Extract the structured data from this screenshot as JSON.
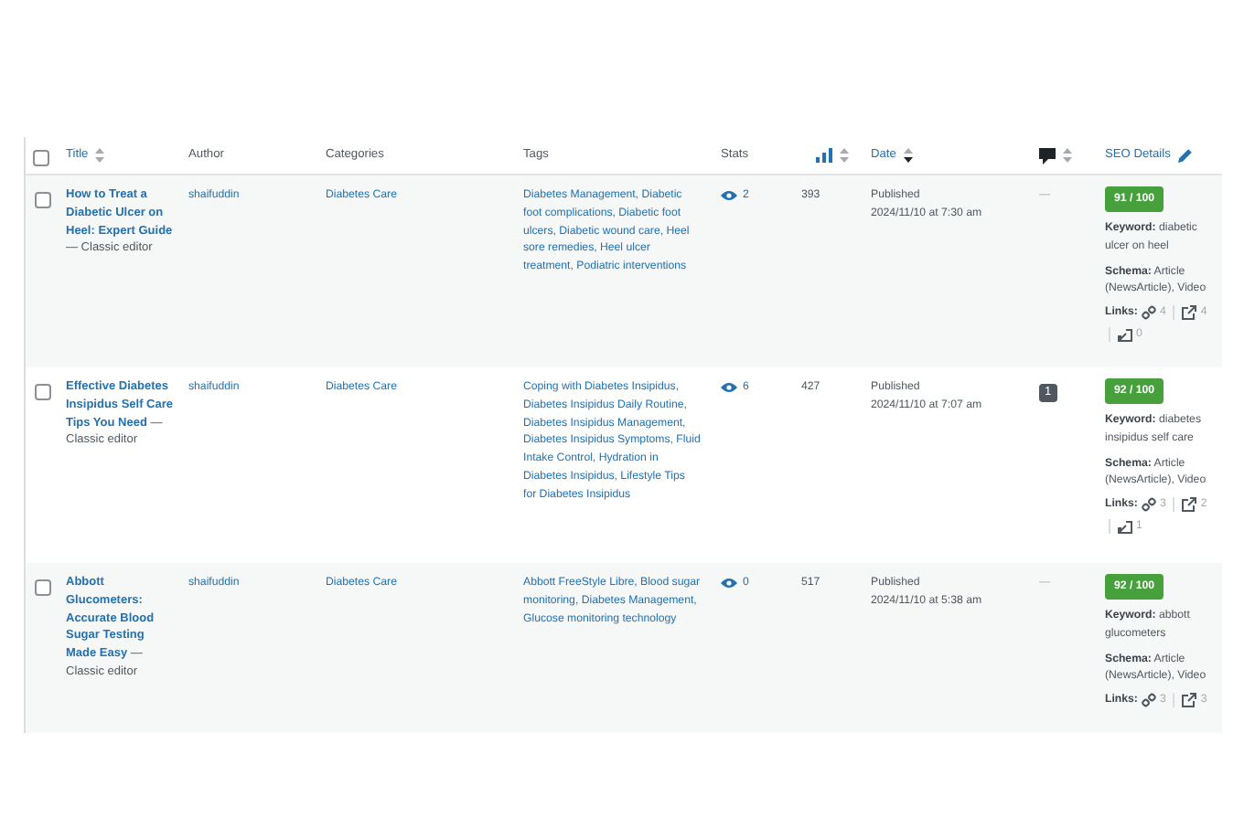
{
  "header": {
    "select_all": {
      "checked": false
    },
    "columns": [
      {
        "kind": "sortable",
        "label": "Title"
      },
      {
        "kind": "plain",
        "label": "Author"
      },
      {
        "kind": "plain",
        "label": "Categories"
      },
      {
        "kind": "plain",
        "label": "Tags"
      },
      {
        "kind": "plain",
        "label": "Stats"
      },
      {
        "kind": "chart-sort"
      },
      {
        "kind": "sortable-active",
        "label": "Date"
      },
      {
        "kind": "comment-sort"
      },
      {
        "kind": "seo",
        "label": "SEO Details"
      }
    ]
  },
  "rows": [
    {
      "checked": false,
      "title": "How to Treat a Diabetic Ulcer on Heel: Expert Guide",
      "editor": "— Classic editor",
      "author": "shaifuddin",
      "category": "Diabetes Care",
      "tags": "Diabetes Management, Diabetic foot complications, Diabetic foot ulcers, Diabetic wound care, Heel sore remedies, Heel ulcer treatment, Podiatric interventions",
      "views": "2",
      "count": "393",
      "status": "Published",
      "date": "2024/11/10 at 7:30 am",
      "comments": {
        "kind": "dash",
        "text": "—"
      },
      "score": "91 / 100",
      "keyword": "**Keyword:** diabetic ulcer on heel",
      "schema": "**Schema:** Article (NewsArticle), Video",
      "links_label": "Links:",
      "internal": "4",
      "external": "4",
      "incoming": "0"
    },
    {
      "checked": false,
      "title": "Effective Diabetes Insipidus Self Care Tips You Need",
      "editor": "— Classic editor",
      "author": "shaifuddin",
      "category": "Diabetes Care",
      "tags": "Coping with Diabetes Insipidus, Diabetes Insipidus Daily Routine, Diabetes Insipidus Management, Diabetes Insipidus Symptoms, Fluid Intake Control, Hydration in Diabetes Insipidus, Lifestyle Tips for Diabetes Insipidus",
      "views": "6",
      "count": "427",
      "status": "Published",
      "date": "2024/11/10 at 7:07 am",
      "comments": {
        "kind": "bubble",
        "text": "1"
      },
      "score": "92 / 100",
      "keyword": "**Keyword:** diabetes insipidus self care",
      "schema": "**Schema:** Article (NewsArticle), Video",
      "links_label": "Links:",
      "internal": "3",
      "external": "2",
      "incoming": "1"
    },
    {
      "checked": false,
      "title": "Abbott Glucometers: Accurate Blood Sugar Testing Made Easy",
      "editor": "— Classic editor",
      "author": "shaifuddin",
      "category": "Diabetes Care",
      "tags": "Abbott FreeStyle Libre, Blood sugar monitoring, Diabetes Management, Glucose monitoring technology",
      "views": "0",
      "count": "517",
      "status": "Published",
      "date": "2024/11/10 at 5:38 am",
      "comments": {
        "kind": "dash",
        "text": "—"
      },
      "score": "92 / 100",
      "keyword": "**Keyword:** abbott glucometers",
      "schema": "**Schema:** Article (NewsArticle), Video",
      "links_label": "Links:",
      "internal": "3",
      "external": "3"
    }
  ]
}
